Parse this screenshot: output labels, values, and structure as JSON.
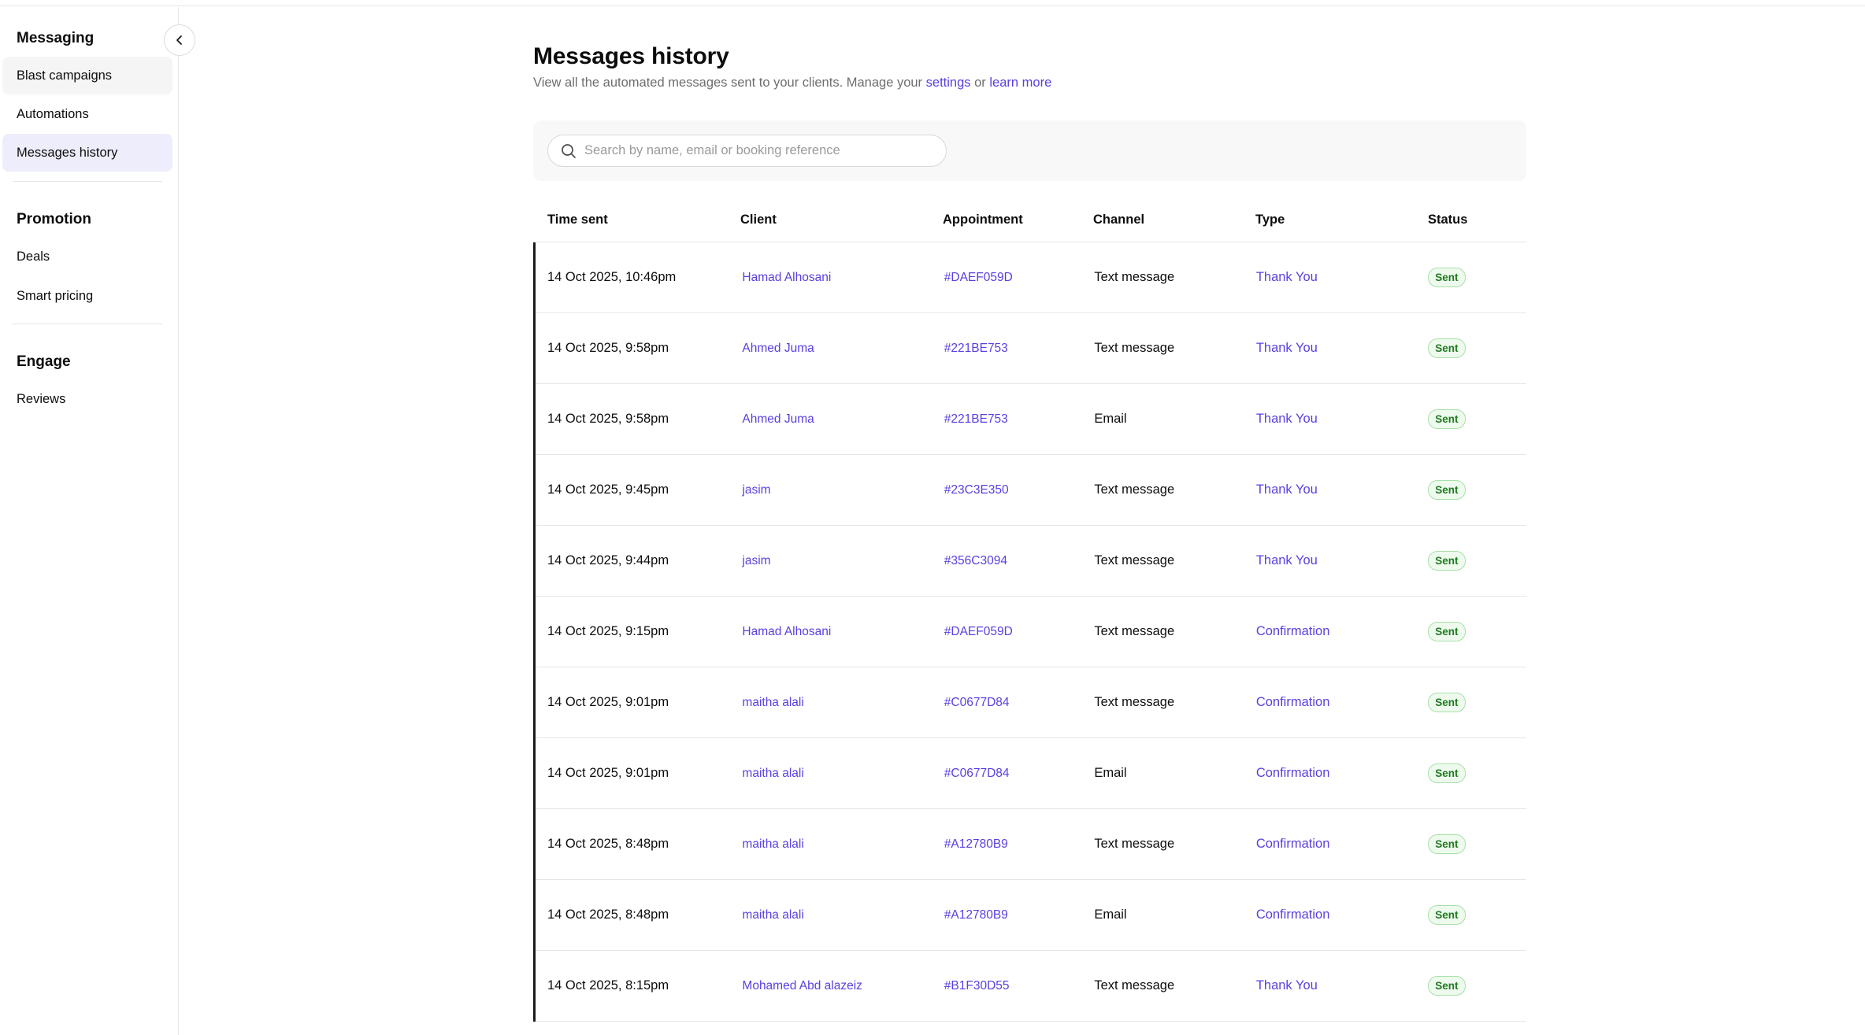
{
  "sidebar": {
    "sections": [
      {
        "title": "Messaging",
        "items": [
          "Blast campaigns",
          "Automations",
          "Messages history"
        ]
      },
      {
        "title": "Promotion",
        "items": [
          "Deals",
          "Smart pricing"
        ]
      },
      {
        "title": "Engage",
        "items": [
          "Reviews"
        ]
      }
    ],
    "active_item": "Messages history",
    "collapse_icon": "chevron-left-icon"
  },
  "page": {
    "title": "Messages history",
    "subtitle_prefix": "View all the automated messages sent to your clients. Manage your",
    "settings_link": "settings",
    "subtitle_or": "or",
    "learn_more_link": "learn more"
  },
  "search": {
    "placeholder": "Search by name, email or booking reference",
    "value": "",
    "icon": "search-icon"
  },
  "table": {
    "columns": [
      "Time sent",
      "Client",
      "Appointment",
      "Channel",
      "Type",
      "Status"
    ],
    "rows": [
      {
        "time": "14 Oct 2025, 10:46pm",
        "client": "Hamad Alhosani",
        "appointment": "#DAEF059D",
        "channel": "Text message",
        "type": "Thank You",
        "status": "Sent"
      },
      {
        "time": "14 Oct 2025, 9:58pm",
        "client": "Ahmed Juma",
        "appointment": "#221BE753",
        "channel": "Text message",
        "type": "Thank You",
        "status": "Sent"
      },
      {
        "time": "14 Oct 2025, 9:58pm",
        "client": "Ahmed Juma",
        "appointment": "#221BE753",
        "channel": "Email",
        "type": "Thank You",
        "status": "Sent"
      },
      {
        "time": "14 Oct 2025, 9:45pm",
        "client": "jasim",
        "appointment": "#23C3E350",
        "channel": "Text message",
        "type": "Thank You",
        "status": "Sent"
      },
      {
        "time": "14 Oct 2025, 9:44pm",
        "client": "jasim",
        "appointment": "#356C3094",
        "channel": "Text message",
        "type": "Thank You",
        "status": "Sent"
      },
      {
        "time": "14 Oct 2025, 9:15pm",
        "client": "Hamad Alhosani",
        "appointment": "#DAEF059D",
        "channel": "Text message",
        "type": "Confirmation",
        "status": "Sent"
      },
      {
        "time": "14 Oct 2025, 9:01pm",
        "client": "maitha alali",
        "appointment": "#C0677D84",
        "channel": "Text message",
        "type": "Confirmation",
        "status": "Sent"
      },
      {
        "time": "14 Oct 2025, 9:01pm",
        "client": "maitha alali",
        "appointment": "#C0677D84",
        "channel": "Email",
        "type": "Confirmation",
        "status": "Sent"
      },
      {
        "time": "14 Oct 2025, 8:48pm",
        "client": "maitha alali",
        "appointment": "#A12780B9",
        "channel": "Text message",
        "type": "Confirmation",
        "status": "Sent"
      },
      {
        "time": "14 Oct 2025, 8:48pm",
        "client": "maitha alali",
        "appointment": "#A12780B9",
        "channel": "Email",
        "type": "Confirmation",
        "status": "Sent"
      },
      {
        "time": "14 Oct 2025, 8:15pm",
        "client": "Mohamed Abd alazeiz",
        "appointment": "#B1F30D55",
        "channel": "Text message",
        "type": "Thank You",
        "status": "Sent"
      }
    ]
  },
  "colors": {
    "accent": "#5a3fe0",
    "active_nav_bg": "#eeedfc",
    "status_sent_bg": "#eefaee",
    "status_sent_text": "#1e7a1e"
  }
}
